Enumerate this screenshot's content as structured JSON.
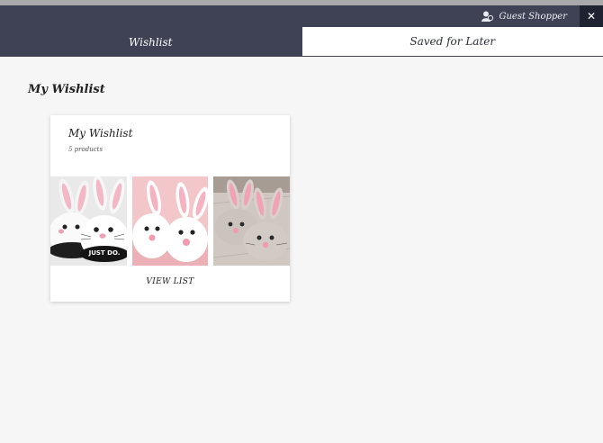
{
  "header": {
    "user_label": "Guest Shopper",
    "close_label": "✕"
  },
  "tabs": [
    {
      "label": "Wishlist",
      "active": true
    },
    {
      "label": "Saved for Later",
      "active": false
    }
  ],
  "main": {
    "section_title": "My Wishlist",
    "card": {
      "title": "My Wishlist",
      "count": "5 products",
      "action": "VIEW LIST",
      "thumbnails": [
        {
          "name": "black-white-bunny-slippers",
          "caption": "JUST DO."
        },
        {
          "name": "fluffy-white-bunny-slippers"
        },
        {
          "name": "grey-bunny-slippers"
        }
      ]
    }
  },
  "colors": {
    "header_bg": "#3e4254",
    "close_bg": "#1f2230",
    "page_bg": "#f6f6f6"
  }
}
